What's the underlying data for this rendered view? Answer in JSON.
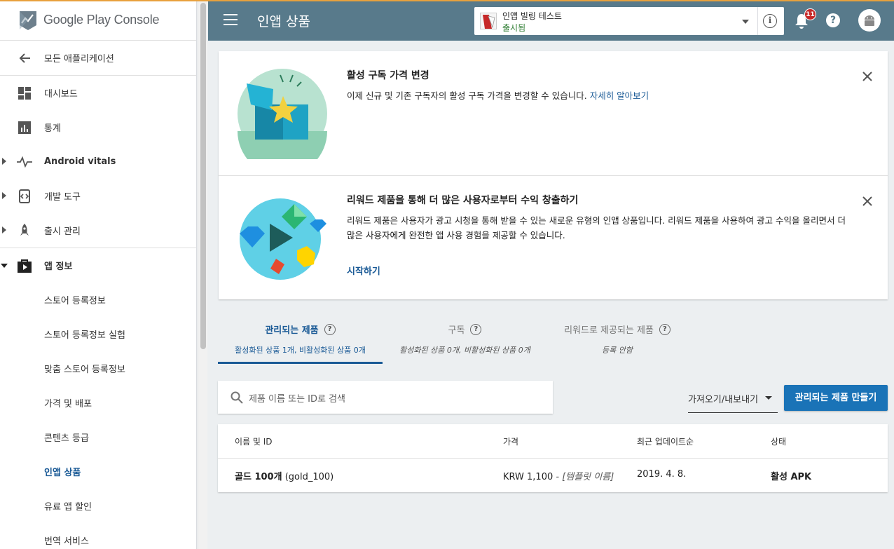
{
  "app": {
    "logo_text": "Google Play Console",
    "page_title": "인앱 상품",
    "selected_app_name": "인앱 빌링 테스트",
    "selected_app_status": "출시됨",
    "notification_count": "11"
  },
  "sidebar": {
    "back_label": "모든 애플리케이션",
    "items": [
      {
        "label": "대시보드",
        "icon": "dashboard-icon"
      },
      {
        "label": "통계",
        "icon": "stats-icon"
      },
      {
        "label": "Android vitals",
        "icon": "vitals-icon"
      },
      {
        "label": "개발 도구",
        "icon": "dev-tools-icon"
      },
      {
        "label": "출시 관리",
        "icon": "rocket-icon"
      },
      {
        "label": "앱 정보",
        "icon": "store-icon"
      },
      {
        "label": "스토어 등록정보"
      },
      {
        "label": "스토어 등록정보 실험"
      },
      {
        "label": "맞춤 스토어 등록정보"
      },
      {
        "label": "가격 및 배포"
      },
      {
        "label": "콘텐츠 등급"
      },
      {
        "label": "인앱 상품"
      },
      {
        "label": "유료 앱 할인"
      },
      {
        "label": "번역 서비스"
      }
    ]
  },
  "cards": {
    "price_change": {
      "title": "활성 구독 가격 변경",
      "body": "이제 신규 및 기존 구독자의 활성 구독 가격을 변경할 수 있습니다.",
      "link": "자세히 알아보기"
    },
    "rewarded": {
      "title": "리워드 제품을 통해 더 많은 사용자로부터 수익 창출하기",
      "body": "리워드 제품은 사용자가 광고 시청을 통해 받을 수 있는 새로운 유형의 인앱 상품입니다. 리워드 제품을 사용하여 광고 수익을 올리면서 더 많은 사용자에게 완전한 앱 사용 경험을 제공할 수 있습니다.",
      "link": "시작하기"
    }
  },
  "tabs": [
    {
      "label": "관리되는 제품",
      "sub": "활성화된 상품 1개, 비활성화된 상품 0개"
    },
    {
      "label": "구독",
      "sub": "활성화된 상품 0개, 비활성화된 상품 0개"
    },
    {
      "label": "리워드로 제공되는 제품",
      "sub": "등록 안함"
    }
  ],
  "search": {
    "placeholder": "제품 이름 또는 ID로 검색"
  },
  "actions": {
    "import_export": "가져오기/내보내기",
    "create_button": "관리되는 제품 만들기"
  },
  "table": {
    "columns": [
      "이름 및 ID",
      "가격",
      "최근 업데이트순",
      "상태"
    ],
    "rows": [
      {
        "name": "골드 100개",
        "id": "(gold_100)",
        "price": "KRW 1,100",
        "template": " - [템플릿 이름]",
        "updated": "2019. 4. 8.",
        "status": "활성 APK"
      }
    ]
  },
  "colors": {
    "topbar": "#587a8b",
    "accent_blue": "#1a5a96",
    "button_blue": "#1a73b7",
    "status_green": "#2e7d32",
    "badge_red": "#c62828"
  }
}
